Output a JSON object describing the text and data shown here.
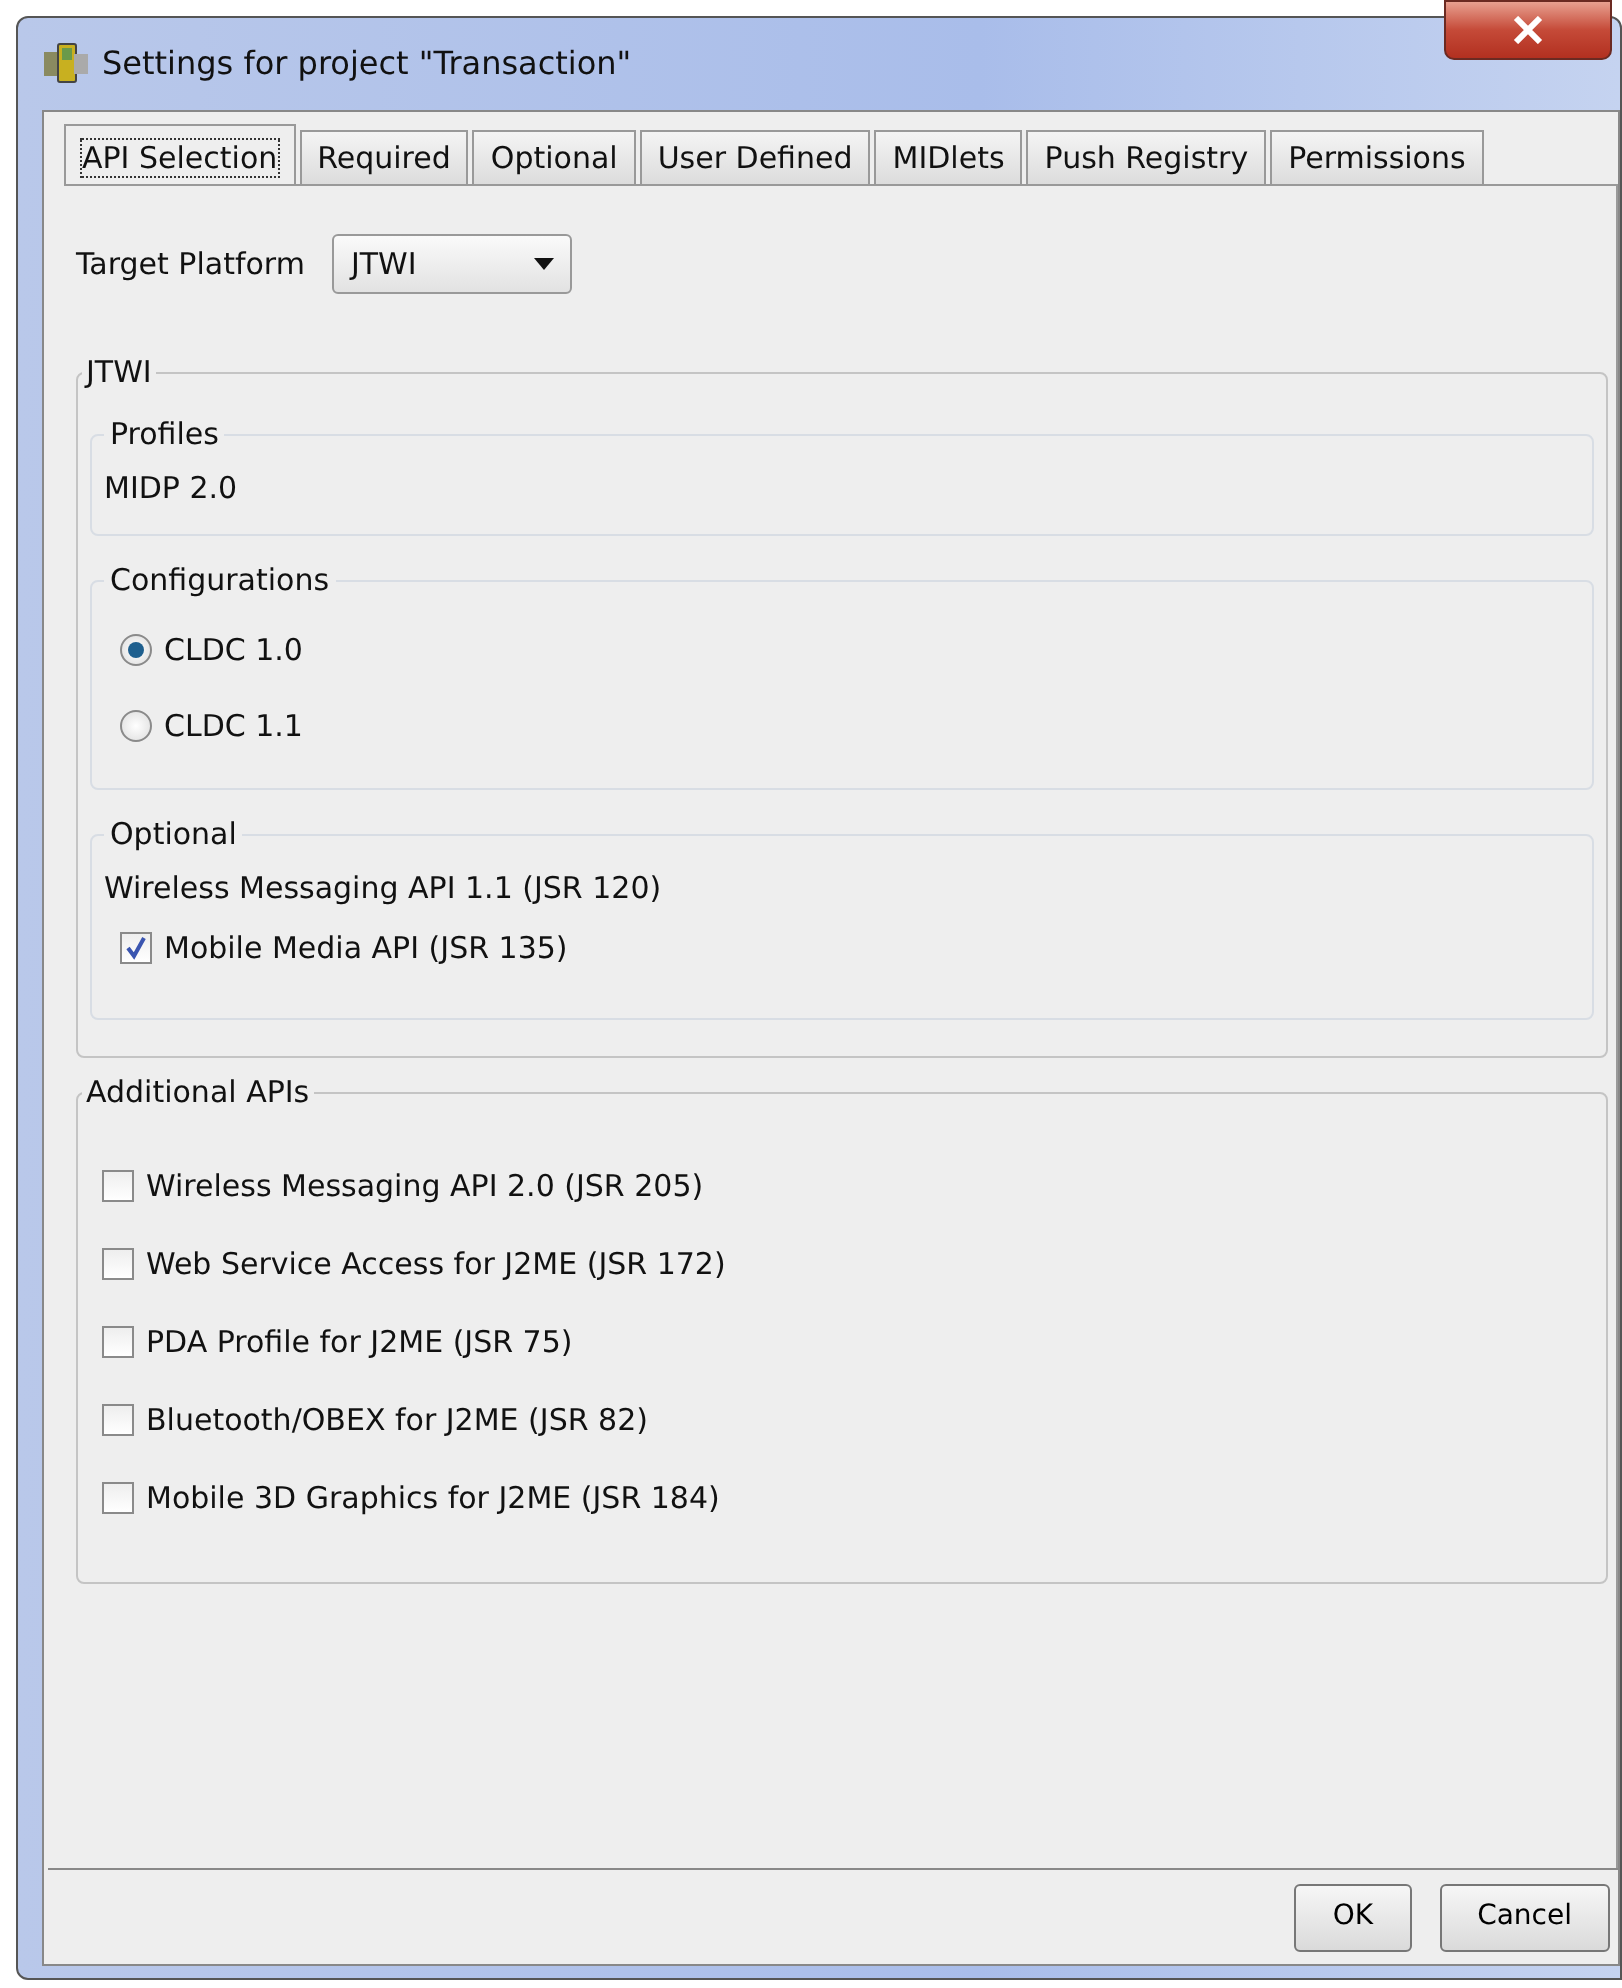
{
  "window": {
    "title": "Settings for project \"Transaction\""
  },
  "tabs": [
    {
      "label": "API Selection",
      "selected": true
    },
    {
      "label": "Required",
      "selected": false
    },
    {
      "label": "Optional",
      "selected": false
    },
    {
      "label": "User Defined",
      "selected": false
    },
    {
      "label": "MIDlets",
      "selected": false
    },
    {
      "label": "Push Registry",
      "selected": false
    },
    {
      "label": "Permissions",
      "selected": false
    }
  ],
  "target_platform": {
    "label": "Target Platform",
    "value": "JTWI"
  },
  "platform_group": {
    "title": "JTWI",
    "profiles": {
      "title": "Profiles",
      "items": [
        "MIDP 2.0"
      ]
    },
    "configurations": {
      "title": "Configurations",
      "options": [
        {
          "label": "CLDC 1.0",
          "selected": true
        },
        {
          "label": "CLDC 1.1",
          "selected": false
        }
      ]
    },
    "optional": {
      "title": "Optional",
      "items": [
        {
          "kind": "text",
          "label": "Wireless Messaging API 1.1 (JSR 120)"
        },
        {
          "kind": "checkbox",
          "label": "Mobile Media API (JSR 135)",
          "checked": true
        }
      ]
    }
  },
  "additional_apis": {
    "title": "Additional APIs",
    "items": [
      {
        "label": "Wireless Messaging API 2.0 (JSR 205)",
        "checked": false
      },
      {
        "label": "Web Service Access for J2ME (JSR 172)",
        "checked": false
      },
      {
        "label": "PDA Profile for J2ME (JSR 75)",
        "checked": false
      },
      {
        "label": "Bluetooth/OBEX for J2ME (JSR 82)",
        "checked": false
      },
      {
        "label": "Mobile 3D Graphics for J2ME (JSR 184)",
        "checked": false
      }
    ]
  },
  "buttons": [
    "OK",
    "Cancel"
  ]
}
